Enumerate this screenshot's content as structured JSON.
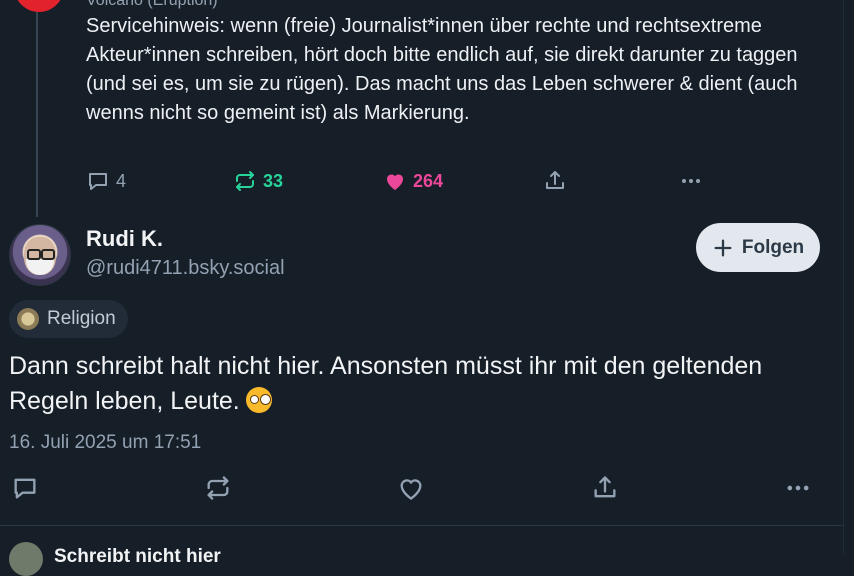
{
  "parent_post": {
    "header_partial": "Volcano (Eruption)",
    "text": "Servicehinweis: wenn (freie) Journalist*innen über rechte und rechtsextreme Akteur*innen schreiben, hört doch bitte endlich auf, sie direkt darunter zu taggen (und sei es, um sie zu rügen). Das macht uns das Leben schwerer & dient (auch wenns nicht so gemeint ist) als Markierung.",
    "reply_count": "4",
    "repost_count": "33",
    "like_count": "264",
    "colors": {
      "repost": "#27d49a",
      "like": "#ec4899"
    }
  },
  "post": {
    "display_name": "Rudi K.",
    "handle": "@rudi4711.bsky.social",
    "follow_label": "Folgen",
    "label_chip": "Religion",
    "text": "Dann schreibt halt nicht hier. Ansonsten müsst ihr mit den geltenden Regeln leben, Leute.",
    "emoji": "woozy-face",
    "date": "16. Juli 2025 um 17:51"
  },
  "icons": [
    "reply-icon",
    "repost-icon",
    "like-icon",
    "share-icon",
    "more-icon",
    "plus-icon"
  ],
  "next_post": {
    "name_partial": "Schreibt nicht hier"
  }
}
